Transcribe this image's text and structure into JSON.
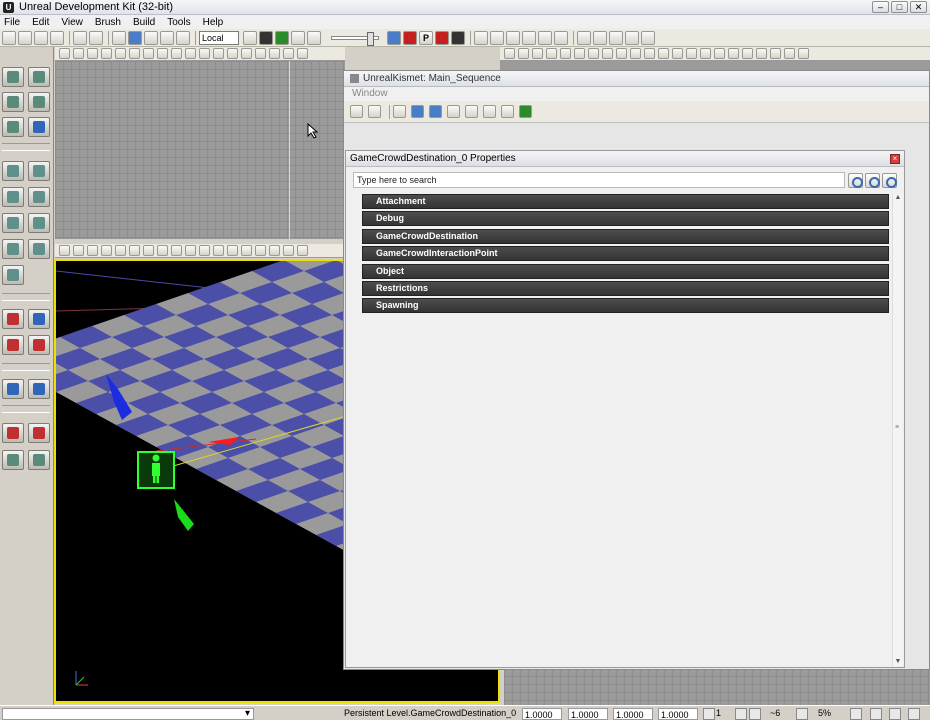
{
  "window": {
    "title": "Unreal Development Kit (32-bit)",
    "min": "–",
    "max": "□",
    "close": "✕",
    "app_icon": "U"
  },
  "menu": [
    "File",
    "Edit",
    "View",
    "Brush",
    "Build",
    "Tools",
    "Help"
  ],
  "toolbar": {
    "coord_space": "Local",
    "p_button": "P"
  },
  "kismet": {
    "title": "UnrealKismet: Main_Sequence",
    "menu_window": "Window"
  },
  "properties": {
    "title": "GameCrowdDestination_0 Properties",
    "search_placeholder": "Type here to search",
    "close": "×",
    "categories": [
      "Attachment",
      "Debug",
      "GameCrowdDestination",
      "GameCrowdInteractionPoint",
      "Object",
      "Restrictions",
      "Spawning"
    ],
    "scroll_up": "▲",
    "scroll_down": "▼",
    "scroll_grip": "≡"
  },
  "status": {
    "level": "Persistent Level.GameCrowdDestination_0",
    "scales": [
      "1.0000",
      "1.0000",
      "1.0000",
      "1.0000"
    ],
    "grid": "1",
    "angle": "~6",
    "percent": "5%"
  },
  "colors": {
    "ortho_bg": "#9b9b9b",
    "persp_tile_a": "#4b4fa8",
    "persp_tile_b": "#9a9a9a",
    "select_border": "#f0e000",
    "category_bg": "#3d3d3d"
  },
  "icons": [
    "cursor-icon",
    "translate-icon",
    "rotate-icon",
    "scale-icon",
    "camera-icon",
    "cube-icon",
    "sphere-icon",
    "cone-icon",
    "cylinder-icon",
    "kismet-icon",
    "search-icon",
    "lock-icon"
  ]
}
